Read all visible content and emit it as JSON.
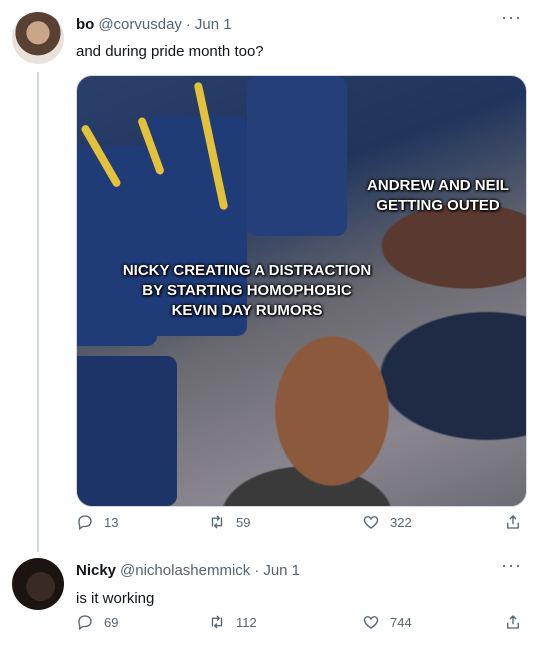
{
  "tweets": [
    {
      "name": "bo",
      "handle": "@corvusday",
      "sep": "·",
      "time": "Jun 1",
      "more": "···",
      "text": "and during pride month too?",
      "media": {
        "captions": [
          "ANDREW AND NEIL GETTING OUTED",
          "NICKY CREATING A DISTRACTION BY STARTING HOMOPHOBIC KEVIN DAY RUMORS"
        ],
        "caption_lines_a": [
          "ANDREW AND NEIL",
          "GETTING OUTED"
        ],
        "caption_lines_b": [
          "NICKY CREATING A DISTRACTION",
          "BY STARTING HOMOPHOBIC",
          "KEVIN DAY RUMORS"
        ]
      },
      "stats": {
        "replies": "13",
        "retweets": "59",
        "likes": "322"
      }
    },
    {
      "name": "Nicky",
      "handle": "@nicholashemmick",
      "sep": "·",
      "time": "Jun 1",
      "more": "···",
      "text": "is it working",
      "stats": {
        "replies": "69",
        "retweets": "112",
        "likes": "744"
      }
    }
  ],
  "icons": [
    "reply-icon",
    "retweet-icon",
    "like-icon",
    "share-icon",
    "more-icon"
  ],
  "colors": {
    "text": "#0f1419",
    "secondary": "#536471",
    "border": "#cfd9de"
  }
}
